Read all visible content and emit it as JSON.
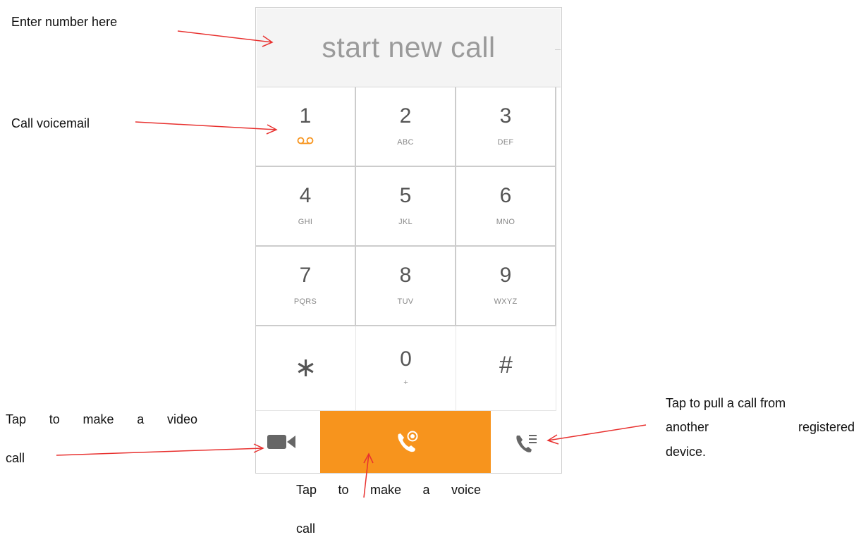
{
  "dialer": {
    "number_placeholder": "start new call",
    "keys": [
      {
        "digit": "1",
        "letters": "",
        "extra": "voicemail-icon"
      },
      {
        "digit": "2",
        "letters": "ABC"
      },
      {
        "digit": "3",
        "letters": "DEF"
      },
      {
        "digit": "4",
        "letters": "GHI"
      },
      {
        "digit": "5",
        "letters": "JKL"
      },
      {
        "digit": "6",
        "letters": "MNO"
      },
      {
        "digit": "7",
        "letters": "PQRS"
      },
      {
        "digit": "8",
        "letters": "TUV"
      },
      {
        "digit": "9",
        "letters": "WXYZ"
      },
      {
        "digit": "∗",
        "letters": ""
      },
      {
        "digit": "0",
        "letters": "+"
      },
      {
        "digit": "#",
        "letters": ""
      }
    ],
    "buttons": {
      "video": "video-camera-icon",
      "voice": "phone-call-icon",
      "pull": "phone-list-icon"
    }
  },
  "colors": {
    "accent": "#f7941d",
    "annotation_arrow": "#e8312f"
  },
  "annotations": {
    "enter_number": "Enter number here",
    "call_voicemail": "Call voicemail",
    "video_call_line1": "Tap to make a video",
    "video_call_line2": "call",
    "voice_call_line1": "Tap to make a voice",
    "voice_call_line2": "call",
    "pull_call_line1": "Tap to pull a call from",
    "pull_call_line2": "another registered",
    "pull_call_line3": "device."
  }
}
